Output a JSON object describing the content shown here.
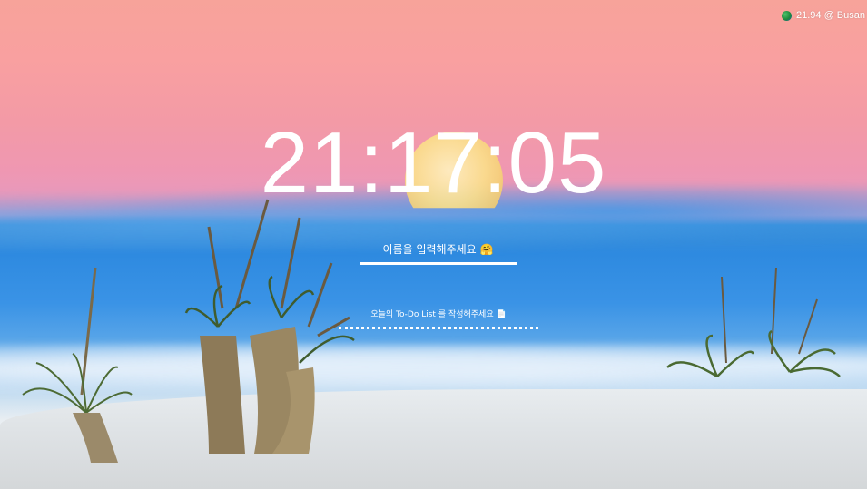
{
  "weather": {
    "icon": "globe-icon",
    "text": "21.94 @ Busan"
  },
  "clock": {
    "time": "21:17:05"
  },
  "name_input": {
    "placeholder": "이름을 입력해주세요 🤗"
  },
  "todo_input": {
    "placeholder": "오늘의 To-Do List 를 작성해주세요 📄"
  },
  "colors": {
    "text": "#ffffff",
    "sky_top": "#f7a39a",
    "sky_mid": "#ef97b2",
    "cloud_blue": "#2e8ae0",
    "sand": "#e8ecef"
  }
}
